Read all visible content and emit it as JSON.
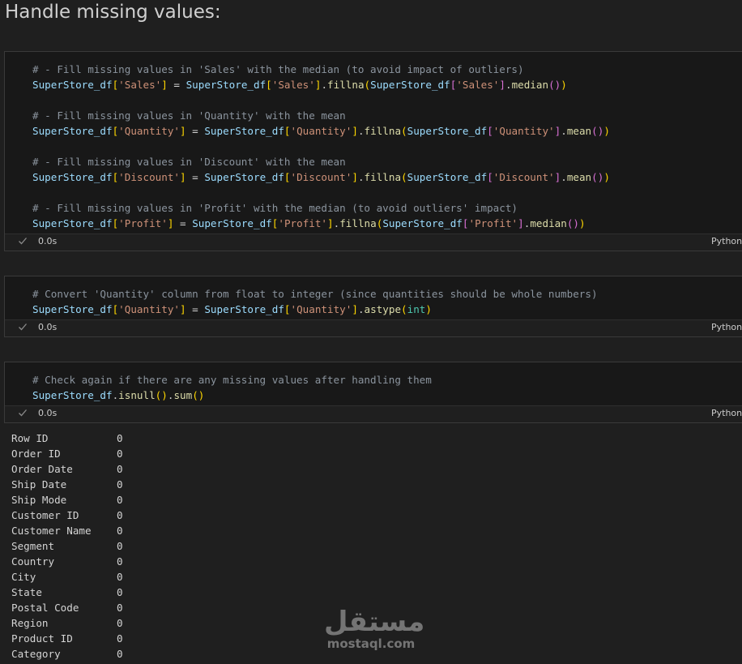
{
  "heading": "Handle missing values:",
  "cells": [
    {
      "status": "0.0s",
      "language": "Python",
      "lines": [
        [
          [
            "# - Fill missing values in 'Sales' with the median (to avoid impact of outliers)",
            "comment"
          ]
        ],
        [
          [
            "SuperStore_df",
            "var"
          ],
          [
            "[",
            "b1"
          ],
          [
            "'Sales'",
            "str"
          ],
          [
            "]",
            "b1"
          ],
          [
            " = ",
            "op"
          ],
          [
            "SuperStore_df",
            "var"
          ],
          [
            "[",
            "b1"
          ],
          [
            "'Sales'",
            "str"
          ],
          [
            "]",
            "b1"
          ],
          [
            ".",
            "punct"
          ],
          [
            "fillna",
            "fn"
          ],
          [
            "(",
            "b1"
          ],
          [
            "SuperStore_df",
            "var"
          ],
          [
            "[",
            "b2"
          ],
          [
            "'Sales'",
            "str"
          ],
          [
            "]",
            "b2"
          ],
          [
            ".",
            "punct"
          ],
          [
            "median",
            "fn"
          ],
          [
            "()",
            "b2"
          ],
          [
            ")",
            "b1"
          ]
        ],
        [],
        [
          [
            "# - Fill missing values in 'Quantity' with the mean",
            "comment"
          ]
        ],
        [
          [
            "SuperStore_df",
            "var"
          ],
          [
            "[",
            "b1"
          ],
          [
            "'Quantity'",
            "str"
          ],
          [
            "]",
            "b1"
          ],
          [
            " = ",
            "op"
          ],
          [
            "SuperStore_df",
            "var"
          ],
          [
            "[",
            "b1"
          ],
          [
            "'Quantity'",
            "str"
          ],
          [
            "]",
            "b1"
          ],
          [
            ".",
            "punct"
          ],
          [
            "fillna",
            "fn"
          ],
          [
            "(",
            "b1"
          ],
          [
            "SuperStore_df",
            "var"
          ],
          [
            "[",
            "b2"
          ],
          [
            "'Quantity'",
            "str"
          ],
          [
            "]",
            "b2"
          ],
          [
            ".",
            "punct"
          ],
          [
            "mean",
            "fn"
          ],
          [
            "()",
            "b2"
          ],
          [
            ")",
            "b1"
          ]
        ],
        [],
        [
          [
            "# - Fill missing values in 'Discount' with the mean",
            "comment"
          ]
        ],
        [
          [
            "SuperStore_df",
            "var"
          ],
          [
            "[",
            "b1"
          ],
          [
            "'Discount'",
            "str"
          ],
          [
            "]",
            "b1"
          ],
          [
            " = ",
            "op"
          ],
          [
            "SuperStore_df",
            "var"
          ],
          [
            "[",
            "b1"
          ],
          [
            "'Discount'",
            "str"
          ],
          [
            "]",
            "b1"
          ],
          [
            ".",
            "punct"
          ],
          [
            "fillna",
            "fn"
          ],
          [
            "(",
            "b1"
          ],
          [
            "SuperStore_df",
            "var"
          ],
          [
            "[",
            "b2"
          ],
          [
            "'Discount'",
            "str"
          ],
          [
            "]",
            "b2"
          ],
          [
            ".",
            "punct"
          ],
          [
            "mean",
            "fn"
          ],
          [
            "()",
            "b2"
          ],
          [
            ")",
            "b1"
          ]
        ],
        [],
        [
          [
            "# - Fill missing values in 'Profit' with the median (to avoid outliers' impact)",
            "comment"
          ]
        ],
        [
          [
            "SuperStore_df",
            "var"
          ],
          [
            "[",
            "b1"
          ],
          [
            "'Profit'",
            "str"
          ],
          [
            "]",
            "b1"
          ],
          [
            " = ",
            "op"
          ],
          [
            "SuperStore_df",
            "var"
          ],
          [
            "[",
            "b1"
          ],
          [
            "'Profit'",
            "str"
          ],
          [
            "]",
            "b1"
          ],
          [
            ".",
            "punct"
          ],
          [
            "fillna",
            "fn"
          ],
          [
            "(",
            "b1"
          ],
          [
            "SuperStore_df",
            "var"
          ],
          [
            "[",
            "b2"
          ],
          [
            "'Profit'",
            "str"
          ],
          [
            "]",
            "b2"
          ],
          [
            ".",
            "punct"
          ],
          [
            "median",
            "fn"
          ],
          [
            "()",
            "b2"
          ],
          [
            ")",
            "b1"
          ]
        ]
      ]
    },
    {
      "status": "0.0s",
      "language": "Python",
      "lines": [
        [
          [
            "# Convert 'Quantity' column from float to integer (since quantities should be whole numbers)",
            "comment"
          ]
        ],
        [
          [
            "SuperStore_df",
            "var"
          ],
          [
            "[",
            "b1"
          ],
          [
            "'Quantity'",
            "str"
          ],
          [
            "]",
            "b1"
          ],
          [
            " = ",
            "op"
          ],
          [
            "SuperStore_df",
            "var"
          ],
          [
            "[",
            "b1"
          ],
          [
            "'Quantity'",
            "str"
          ],
          [
            "]",
            "b1"
          ],
          [
            ".",
            "punct"
          ],
          [
            "astype",
            "fn"
          ],
          [
            "(",
            "b1"
          ],
          [
            "int",
            "builtin"
          ],
          [
            ")",
            "b1"
          ]
        ]
      ]
    },
    {
      "status": "0.0s",
      "language": "Python",
      "lines": [
        [
          [
            "# Check again if there are any missing values after handling them",
            "comment"
          ]
        ],
        [
          [
            "SuperStore_df",
            "var"
          ],
          [
            ".",
            "punct"
          ],
          [
            "isnull",
            "fn"
          ],
          [
            "()",
            "b1"
          ],
          [
            ".",
            "punct"
          ],
          [
            "sum",
            "fn"
          ],
          [
            "()",
            "b1"
          ]
        ]
      ]
    }
  ],
  "output": [
    {
      "column": "Row ID",
      "count": "0"
    },
    {
      "column": "Order ID",
      "count": "0"
    },
    {
      "column": "Order Date",
      "count": "0"
    },
    {
      "column": "Ship Date",
      "count": "0"
    },
    {
      "column": "Ship Mode",
      "count": "0"
    },
    {
      "column": "Customer ID",
      "count": "0"
    },
    {
      "column": "Customer Name",
      "count": "0"
    },
    {
      "column": "Segment",
      "count": "0"
    },
    {
      "column": "Country",
      "count": "0"
    },
    {
      "column": "City",
      "count": "0"
    },
    {
      "column": "State",
      "count": "0"
    },
    {
      "column": "Postal Code",
      "count": "0"
    },
    {
      "column": "Region",
      "count": "0"
    },
    {
      "column": "Product ID",
      "count": "0"
    },
    {
      "column": "Category",
      "count": "0"
    }
  ],
  "watermark": {
    "logo": "مستقل",
    "domain": "mostaql.com"
  },
  "icons": {
    "status": "check-icon"
  }
}
